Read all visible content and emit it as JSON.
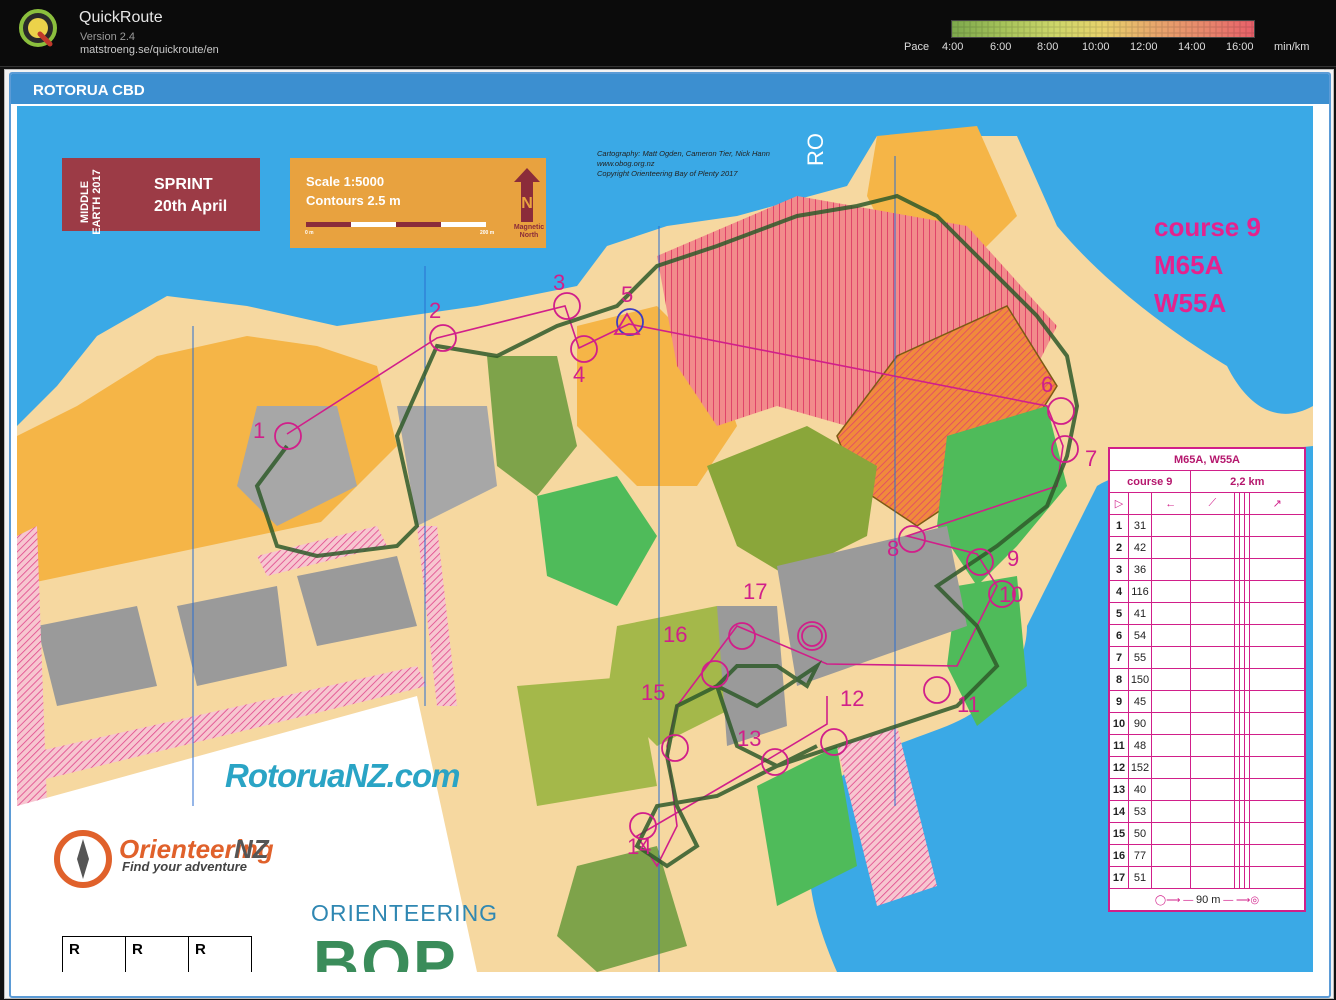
{
  "app": {
    "title": "QuickRoute",
    "version": "Version 2.4",
    "url": "matstroeng.se/quickroute/en"
  },
  "pace": {
    "label": "Pace",
    "ticks": [
      "4:00",
      "6:00",
      "8:00",
      "10:00",
      "12:00",
      "14:00",
      "16:00"
    ],
    "unit": "min/km",
    "gradient": [
      "#7da84d",
      "#a6c35a",
      "#cdd66a",
      "#e8d26c",
      "#e8a76c",
      "#e8876c",
      "#e8606a"
    ]
  },
  "map": {
    "header": "ROTORUA CBD",
    "event": {
      "series": "MIDDLE EARTH 2017",
      "type": "SPRINT",
      "date": "20th April"
    },
    "scale": {
      "scale": "Scale 1:5000",
      "contours": "Contours 2.5 m",
      "zero": "0 m",
      "end": "200 m",
      "north": "Magnetic North"
    },
    "credits": [
      "Cartography: Matt Ogden, Cameron Tier, Nick Hann",
      "www.obog.org.nz",
      "Copyright Orienteering Bay of Plenty 2017"
    ],
    "course_label": [
      "course 9",
      "M65A",
      "W55A"
    ],
    "map_text": "RO",
    "controls": [
      {
        "n": "1"
      },
      {
        "n": "2"
      },
      {
        "n": "3"
      },
      {
        "n": "4"
      },
      {
        "n": "5"
      },
      {
        "n": "6"
      },
      {
        "n": "7"
      },
      {
        "n": "8"
      },
      {
        "n": "9"
      },
      {
        "n": "10"
      },
      {
        "n": "11"
      },
      {
        "n": "12"
      },
      {
        "n": "13"
      },
      {
        "n": "14"
      },
      {
        "n": "15"
      },
      {
        "n": "16"
      },
      {
        "n": "17"
      }
    ],
    "descriptions": {
      "title": "M65A, W55A",
      "course": "course 9",
      "length": "2,2 km",
      "rows": [
        {
          "num": "1",
          "code": "31"
        },
        {
          "num": "2",
          "code": "42"
        },
        {
          "num": "3",
          "code": "36"
        },
        {
          "num": "4",
          "code": "116"
        },
        {
          "num": "5",
          "code": "41"
        },
        {
          "num": "6",
          "code": "54"
        },
        {
          "num": "7",
          "code": "55"
        },
        {
          "num": "8",
          "code": "150"
        },
        {
          "num": "9",
          "code": "45"
        },
        {
          "num": "10",
          "code": "90"
        },
        {
          "num": "11",
          "code": "48"
        },
        {
          "num": "12",
          "code": "152"
        },
        {
          "num": "13",
          "code": "40"
        },
        {
          "num": "14",
          "code": "53"
        },
        {
          "num": "15",
          "code": "50"
        },
        {
          "num": "16",
          "code": "77"
        },
        {
          "num": "17",
          "code": "51"
        }
      ],
      "finish": "90 m"
    },
    "logos": {
      "rotorua": "RotoruaNZ.com",
      "onz_1": "Orienteering",
      "onz_2": "NZ",
      "onz_tag": "Find your adventure",
      "bop_top": "ORIENTEERING",
      "bop_big": "BOP"
    },
    "r_boxes": [
      "R",
      "R",
      "R"
    ]
  }
}
